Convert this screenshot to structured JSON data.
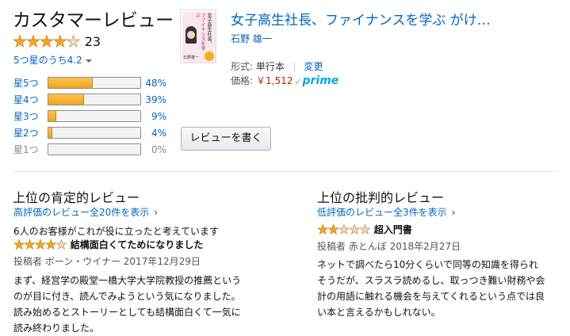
{
  "header": {
    "title": "カスタマーレビュー",
    "rating_count": "23",
    "average_text": "5つ星のうち4.2"
  },
  "ratings": [
    {
      "label": "星5つ",
      "pct_text": "48%",
      "pct": 48
    },
    {
      "label": "星4つ",
      "pct_text": "39%",
      "pct": 39
    },
    {
      "label": "星3つ",
      "pct_text": "9%",
      "pct": 9
    },
    {
      "label": "星2つ",
      "pct_text": "4%",
      "pct": 4
    },
    {
      "label": "星1つ",
      "pct_text": "0%",
      "pct": 0
    }
  ],
  "overall_stars": 4.2,
  "write_review_label": "レビューを書く",
  "product": {
    "title": "女子高生社長、ファイナンスを学ぶ がけ…",
    "author": "石野 雄一",
    "format_label": "形式:",
    "format_value": "単行本",
    "change_label": "変更",
    "price_label": "価格:",
    "price": "￥1,512",
    "prime": "prime",
    "cover_text_top": "女子高生社長、",
    "cover_text_mid": "ファイナンスを学ぶ",
    "cover_badge": "石野雄一"
  },
  "positive": {
    "heading": "上位の肯定的レビュー",
    "all_link": "高評価のレビュー全20件を表示",
    "helpful": "6人のお客様がこれが役に立ったと考えています",
    "stars": 4,
    "review_title": "結構面白くてためになりました",
    "byline": "投稿者 ボーン・ウイナー 2017年12月29日",
    "body": "まず、経営学の殿堂一橋大学大学院教授の推薦というのが目に付き、読んでみようという気になりました。読み始めるとストーリーとしても結構面白くて一気に読み終わりました。",
    "body_lines": [
      "まず、経営学の殿堂一橋大学大学院教授の推薦という",
      "のが目に付き、読んでみようという気になりました。",
      "読み始めるとストーリーとしても結構面白くて一気に",
      "読み終わりました。"
    ]
  },
  "critical": {
    "heading": "上位の批判的レビュー",
    "all_link": "低評価のレビュー全3件を表示",
    "stars": 2,
    "review_title": "超入門書",
    "byline": "投稿者 赤とんぼ 2018年2月27日",
    "body_lines": [
      "ネットで調べたら10分くらいで同等の知識を得られ",
      "そうだが、スラスラ読めるし、取っつき難い財務や会",
      "計の用語に触れる機会を与えてくれるという点では良",
      "い本と言えるかもしれない。"
    ]
  },
  "colors": {
    "link": "#0066c0",
    "star": "#f5a623",
    "price": "#b12704",
    "prime": "#00a8e1"
  }
}
